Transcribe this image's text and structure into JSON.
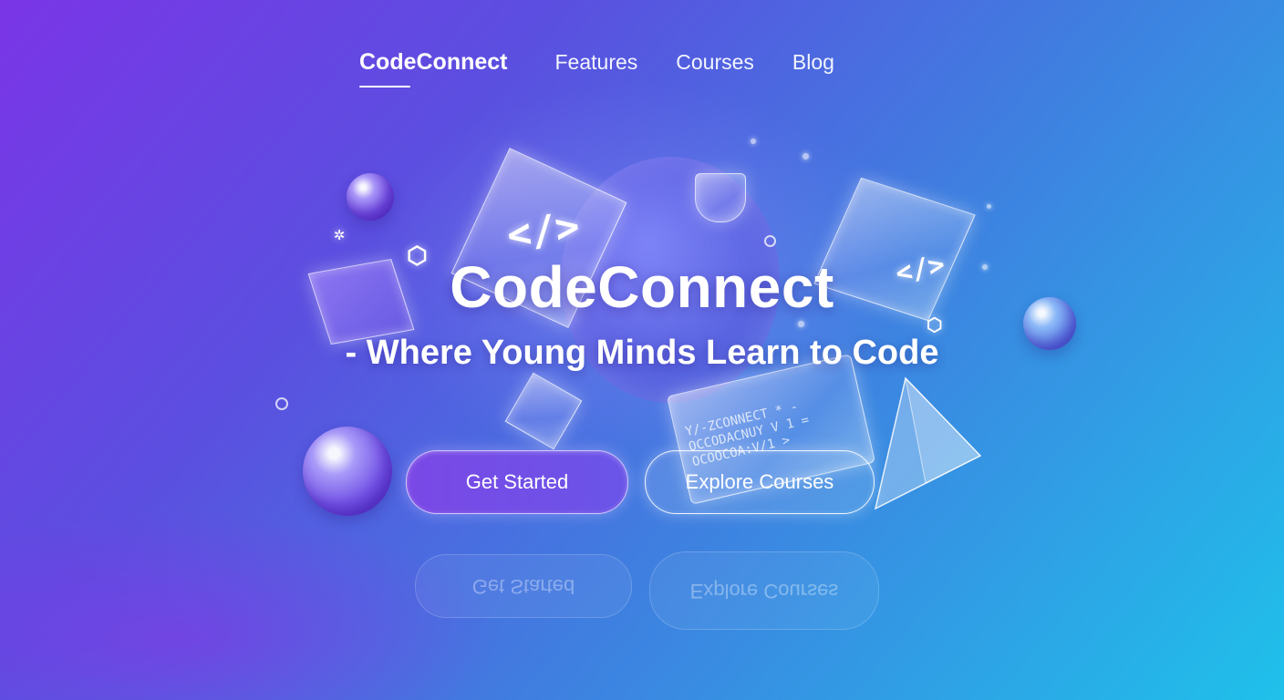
{
  "nav": {
    "brand": "CodeConnect",
    "links": [
      "Features",
      "Courses",
      "Blog"
    ]
  },
  "hero": {
    "title": "CodeConnect",
    "subtitle": "- Where Young Minds Learn to Code"
  },
  "buttons": {
    "primary": "Get Started",
    "secondary": "Explore Courses"
  },
  "decor": {
    "code_glyph": "</>",
    "panel_lines": [
      "Y/-ZCONNECT * -",
      "OCCODACNUY V 1 =",
      "OCOOCOA:V/1 >"
    ]
  },
  "colors": {
    "gradient_start": "#7a35e6",
    "gradient_end": "#1fc1ea",
    "primary_button": "#7a48e6"
  }
}
